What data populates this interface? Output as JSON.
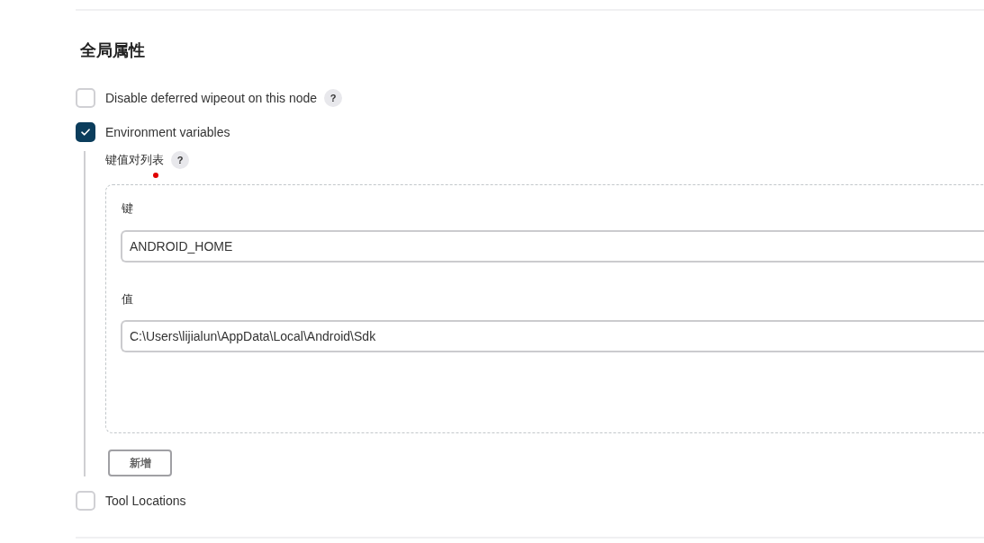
{
  "section": {
    "title": "全局属性"
  },
  "properties": [
    {
      "label": "Disable deferred wipeout on this node",
      "checked": false,
      "help": "?"
    },
    {
      "label": "Environment variables",
      "checked": true,
      "details": {
        "list_label": "键值对列表",
        "list_help": "?",
        "entries": [
          {
            "key_label": "键",
            "key_value": "ANDROID_HOME",
            "value_label": "值",
            "value_value": "C:\\Users\\lijialun\\AppData\\Local\\Android\\Sdk"
          }
        ],
        "add_button": "新增"
      }
    },
    {
      "label": "Tool Locations",
      "checked": false
    }
  ]
}
